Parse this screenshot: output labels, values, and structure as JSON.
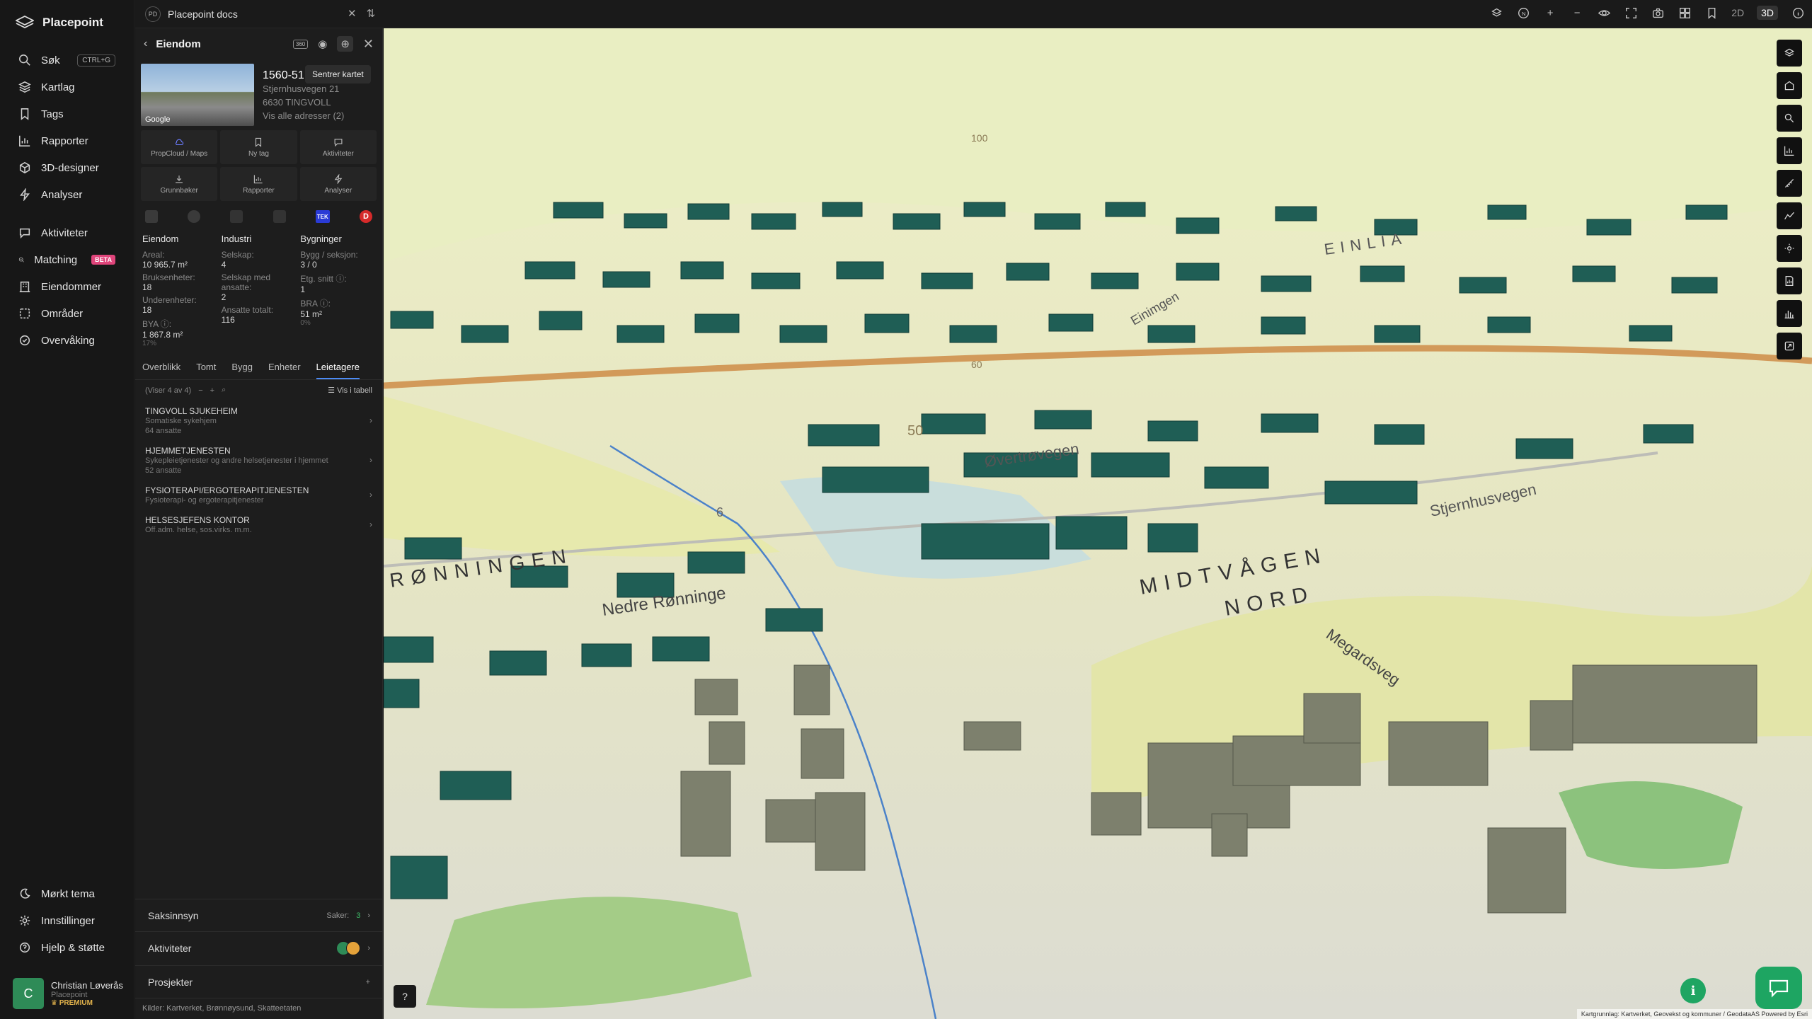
{
  "app": {
    "name": "Placepoint"
  },
  "nav": {
    "items": [
      {
        "label": "Søk",
        "shortcut": "CTRL+G"
      },
      {
        "label": "Kartlag"
      },
      {
        "label": "Tags"
      },
      {
        "label": "Rapporter"
      },
      {
        "label": "3D-designer"
      },
      {
        "label": "Analyser"
      }
    ],
    "items2": [
      {
        "label": "Aktiviteter"
      },
      {
        "label": "Matching",
        "badge": "BETA"
      },
      {
        "label": "Eiendommer"
      },
      {
        "label": "Områder"
      },
      {
        "label": "Overvåking"
      }
    ],
    "bottom": [
      {
        "label": "Mørkt tema"
      },
      {
        "label": "Innstillinger"
      },
      {
        "label": "Hjelp & støtte"
      }
    ],
    "user": {
      "initial": "C",
      "name": "Christian Løverås",
      "org": "Placepoint",
      "plan": "PREMIUM"
    }
  },
  "topbar": {
    "workspace_badge": "PD",
    "workspace": "Placepoint docs",
    "mode_2d": "2D",
    "mode_3d": "3D",
    "north": "N"
  },
  "panel": {
    "title": "Eiendom",
    "badge": "360",
    "tooltip": "Sentrer kartet",
    "thumb_label": "Google",
    "property": {
      "id": "1560-51",
      "street": "Stjernhusvegen 21",
      "city": "6630 TINGVOLL",
      "all_addresses": "Vis alle adresser (2)"
    },
    "actions": [
      "PropCloud / Maps",
      "Ny tag",
      "Aktiviteter",
      "Grunnbøker",
      "Rapporter",
      "Analyser"
    ],
    "src_tek": "TEK",
    "src_d": "D",
    "stats": {
      "col1": {
        "title": "Eiendom",
        "rows": [
          {
            "k": "Areal:",
            "v": "10 965.7 m²"
          },
          {
            "k": "Bruksenheter:",
            "v": "18"
          },
          {
            "k": "Underenheter:",
            "v": "18"
          },
          {
            "k": "BYA ⓘ:",
            "v": "1 867.8 m²",
            "s": "17%"
          }
        ]
      },
      "col2": {
        "title": "Industri",
        "rows": [
          {
            "k": "Selskap:",
            "v": "4"
          },
          {
            "k": "Selskap med ansatte:",
            "v": "2"
          },
          {
            "k": "Ansatte totalt:",
            "v": "116"
          }
        ]
      },
      "col3": {
        "title": "Bygninger",
        "rows": [
          {
            "k": "Bygg / seksjon:",
            "v": "3 / 0"
          },
          {
            "k": "Etg. snitt ⓘ:",
            "v": "1"
          },
          {
            "k": "BRA ⓘ:",
            "v": "51 m²",
            "s": "0%"
          }
        ]
      }
    },
    "tabs": [
      "Overblikk",
      "Tomt",
      "Bygg",
      "Enheter",
      "Leietagere"
    ],
    "list_count": "(Viser 4 av 4)",
    "list_view": "Vis i tabell",
    "tenants": [
      {
        "name": "TINGVOLL SJUKEHEIM",
        "desc": "Somatiske sykehjem",
        "extra": "64 ansatte"
      },
      {
        "name": "HJEMMETJENESTEN",
        "desc": "Sykepleietjenester og andre helsetjenester i hjemmet",
        "extra": "52 ansatte"
      },
      {
        "name": "FYSIOTERAPI/ERGOTERAPITJENESTEN",
        "desc": "Fysioterapi- og ergoterapitjenester",
        "extra": ""
      },
      {
        "name": "HELSESJEFENS KONTOR",
        "desc": "Off.adm. helse, sos.virks. m.m.",
        "extra": ""
      }
    ],
    "sections": {
      "saksinnsyn": "Saksinnsyn",
      "saker_label": "Saker:",
      "saker_count": "3",
      "aktiviteter": "Aktiviteter",
      "prosjekter": "Prosjekter"
    },
    "sources": "Kilder:  Kartverket,  Brønnøysund,  Skatteetaten"
  },
  "map": {
    "labels": {
      "road1": "Øvertrøvegen",
      "road2": "Stjernhusvegen",
      "road3": "Nedre Rønninge",
      "road4": "Megardsveg",
      "road5": "Einimgen",
      "place1": "MIDTVÅGEN",
      "place2": "NORD",
      "place3": "RØNNINGEN",
      "place4": "EINLIA",
      "contour1": "50",
      "contour2": "6",
      "contour3": "100",
      "contour4": "60"
    },
    "attribution": "Kartgrunnlag: Kartverket, Geovekst og kommuner / GeodataAS Powered by Esri",
    "help": "?",
    "info": "i"
  },
  "colors": {
    "accent": "#1ea562",
    "building": "#1f5e55",
    "building_hl": "#7d806d",
    "beta": "#e0457b"
  }
}
